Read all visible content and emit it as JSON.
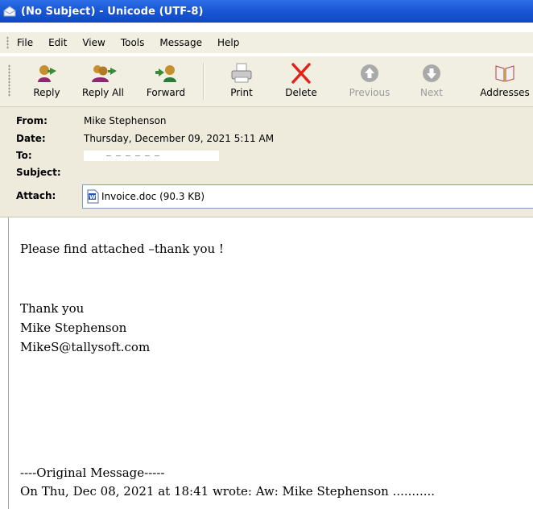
{
  "window": {
    "title": "(No Subject) - Unicode (UTF-8)",
    "icon": "envelope-icon"
  },
  "menu": [
    "File",
    "Edit",
    "View",
    "Tools",
    "Message",
    "Help"
  ],
  "toolbar": {
    "reply": {
      "label": "Reply",
      "icon": "reply-icon"
    },
    "reply_all": {
      "label": "Reply All",
      "icon": "reply-all-icon"
    },
    "forward": {
      "label": "Forward",
      "icon": "forward-icon"
    },
    "print": {
      "label": "Print",
      "icon": "printer-icon"
    },
    "delete": {
      "label": "Delete",
      "icon": "delete-x-icon",
      "color": "#e0241b"
    },
    "previous": {
      "label": "Previous",
      "icon": "up-arrow-icon",
      "enabled": false
    },
    "next": {
      "label": "Next",
      "icon": "down-arrow-icon",
      "enabled": false
    },
    "addresses": {
      "label": "Addresses",
      "icon": "address-book-icon"
    }
  },
  "header": {
    "from_label": "From:",
    "from_value": "Mike Stephenson",
    "date_label": "Date:",
    "date_value": "Thursday, December 09, 2021 5:11 AM",
    "to_label": "To:",
    "to_value": "",
    "subject_label": "Subject:",
    "subject_value": "",
    "attach_label": "Attach:",
    "attachment": "Invoice.doc (90.3 KB)"
  },
  "body": {
    "line1": "Please find attached –thank you !",
    "line2": "Thank you",
    "line3": "Mike Stephenson",
    "line4": "MikeS@tallysoft.com",
    "line5": "----Original Message-----",
    "line6": "On Thu, Dec 08, 2021 at 18:41 wrote: Aw: Mike Stephenson ..........."
  }
}
